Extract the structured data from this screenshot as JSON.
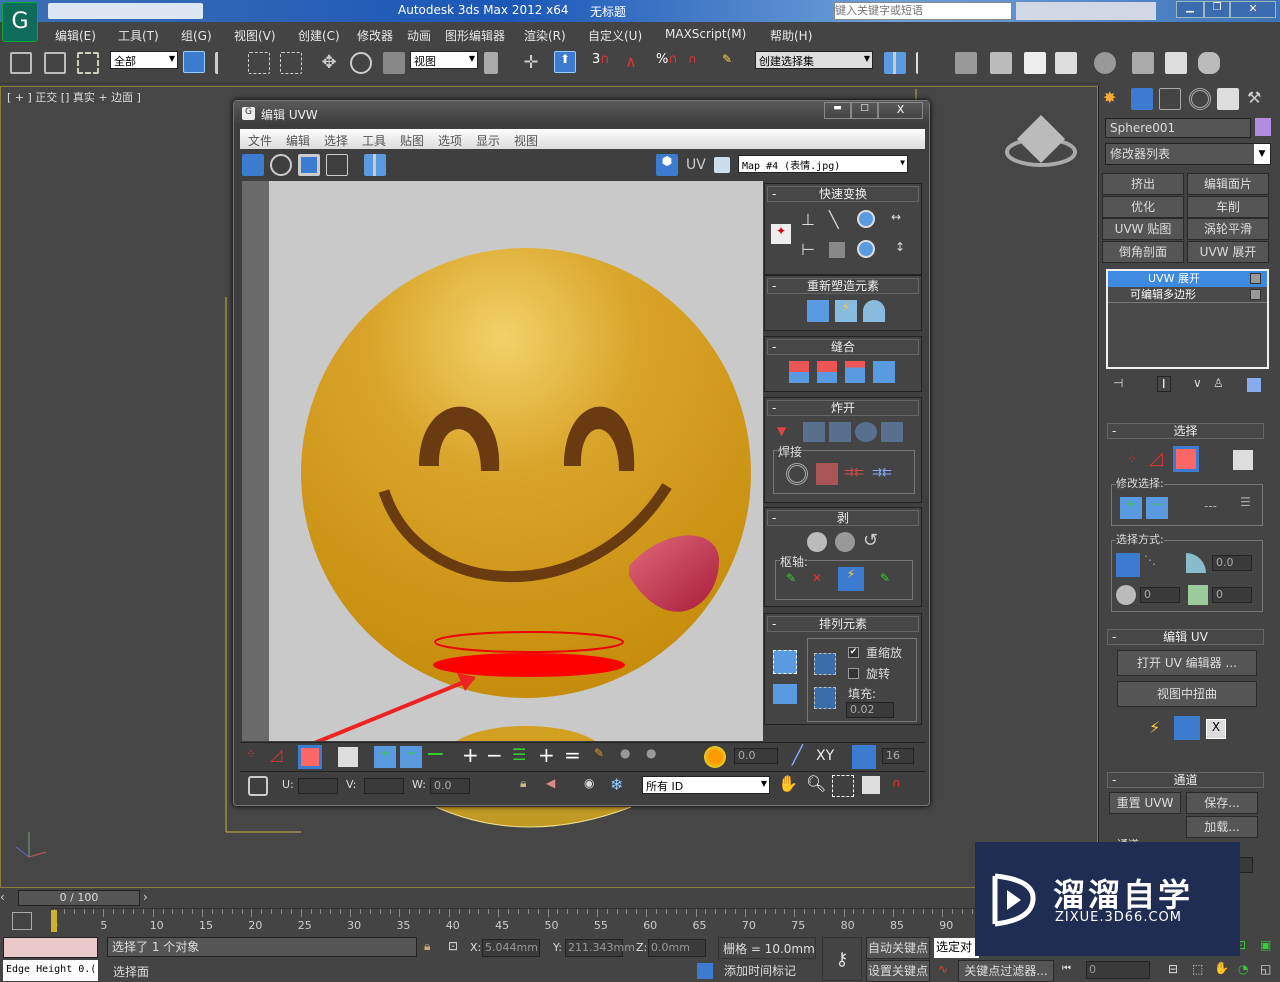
{
  "app": {
    "title": "Autodesk 3ds Max  2012 x64",
    "doc": "无标题",
    "search_placeholder": "键入关键字或短语"
  },
  "menu": [
    "编辑(E)",
    "工具(T)",
    "组(G)",
    "视图(V)",
    "创建(C)",
    "修改器",
    "动画",
    "图形编辑器",
    "渲染(R)",
    "自定义(U)",
    "MAXScript(M)",
    "帮助(H)"
  ],
  "toolbar": {
    "filter": "全部",
    "ref_coord": "视图",
    "selection_set": "创建选择集",
    "snap_angle": "3",
    "snap_percent": "%"
  },
  "viewport": {
    "label": "[ + ] 正交 [] 真实 + 边面 ]"
  },
  "uvw": {
    "title": "编辑 UVW",
    "menu": [
      "文件",
      "编辑",
      "选择",
      "工具",
      "贴图",
      "选项",
      "显示",
      "视图"
    ],
    "uv_label": "UV",
    "map_select": "Map #4 (表情.jpg)",
    "panels": {
      "quick_transform": "快速变换",
      "reshape": "重新塑造元素",
      "stitch": "缝合",
      "explode": "炸开",
      "weld": "焊接",
      "peel": "剥",
      "pivot": "枢轴:",
      "arrange": "排列元素",
      "rescale": "重缩放",
      "rescale_checked": true,
      "rotate": "旋转",
      "rotate_checked": false,
      "padding_label": "填充:",
      "padding": "0.02"
    },
    "bottom": {
      "soft_value": "0.0",
      "xy_label": "XY",
      "grid_value": "16",
      "u_label": "U:",
      "v_label": "V:",
      "w_label": "W:",
      "w_value": "0.0",
      "id_select": "所有 ID"
    }
  },
  "cmd": {
    "object_name": "Sphere001",
    "object_color": "#b08de0",
    "modifier_list": "修改器列表",
    "mod_buttons": [
      "挤出",
      "编辑面片",
      "优化",
      "车削",
      "UVW 贴图",
      "涡轮平滑",
      "倒角剖面",
      "UVW 展开"
    ],
    "stack": [
      "UVW 展开",
      "可编辑多边形"
    ],
    "select": {
      "title": "选择",
      "modify": "修改选择:",
      "method": "选择方式:",
      "angle": "0.0",
      "v1": "0",
      "v2": "0"
    },
    "edit_uv": {
      "title": "编辑 UV",
      "open": "打开 UV 编辑器 ...",
      "distort": "视图中扭曲"
    },
    "channel": {
      "title": "通道",
      "reset": "重置 UVW",
      "save": "保存...",
      "load": "加载...",
      "label": "通道",
      "value": "1"
    }
  },
  "timeline": {
    "frame": "0 / 100",
    "ticks": [
      "0",
      "5",
      "10",
      "15",
      "20",
      "25",
      "30",
      "35",
      "40",
      "45",
      "50",
      "55",
      "60",
      "65",
      "70",
      "75",
      "80",
      "85",
      "90"
    ]
  },
  "status": {
    "selected": "选择了 1 个对象",
    "prompt": "选择面",
    "script": "Edge Height 0.(",
    "x_label": "X:",
    "x": "5.044mm",
    "y_label": "Y:",
    "y": "211.343mm",
    "z_label": "Z:",
    "z": "0.0mm",
    "grid": "栅格 = 10.0mm",
    "auto_key": "自动关键点",
    "set_key": "设置关键点",
    "key_mode": "选定对",
    "add_time_tag": "添加时间标记",
    "key_filter": "关键点过滤器...",
    "frame": "0"
  },
  "watermark": {
    "cn": "溜溜自学",
    "url": "ZIXUE.3D66.COM"
  }
}
